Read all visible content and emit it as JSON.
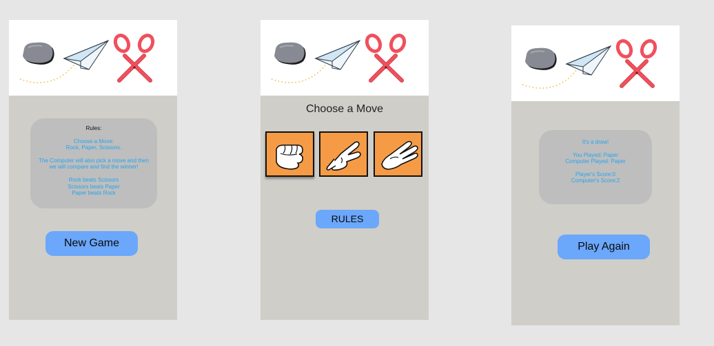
{
  "screens": {
    "rules": {
      "title": "Rules:",
      "move_text": "Choose a Move:",
      "options_text": "Rock, Paper, Scissors.",
      "computer_text": "The Computer will also pick a move and then we will compare and find the winner!",
      "rule_1": "Rock beats Scissors",
      "rule_2": "Scissors beats Paper",
      "rule_3": "Paper beats Rock",
      "button_label": "New Game"
    },
    "choose": {
      "title": "Choose a Move",
      "moves": [
        {
          "name": "Rock",
          "icon": "fist-icon"
        },
        {
          "name": "Paper",
          "icon": "open-hand-icon"
        },
        {
          "name": "Scissors",
          "icon": "peace-hand-icon"
        }
      ],
      "button_label": "RULES"
    },
    "result": {
      "outcome": "It's a draw!",
      "player_move": "You Played: Paper",
      "computer_move": "Computer Played: Paper",
      "player_score": "Player's Score:0",
      "computer_score": "Computer's Score:2",
      "button_label": "Play Again"
    }
  },
  "colors": {
    "page_bg": "#e6e6e6",
    "panel_bg": "#cfcec8",
    "card_bg": "#bebebe",
    "card_text": "#27a4ec",
    "button_bg": "#6ba7fb",
    "move_bg": "#f59b45",
    "scissors_red": "#f0505d"
  }
}
